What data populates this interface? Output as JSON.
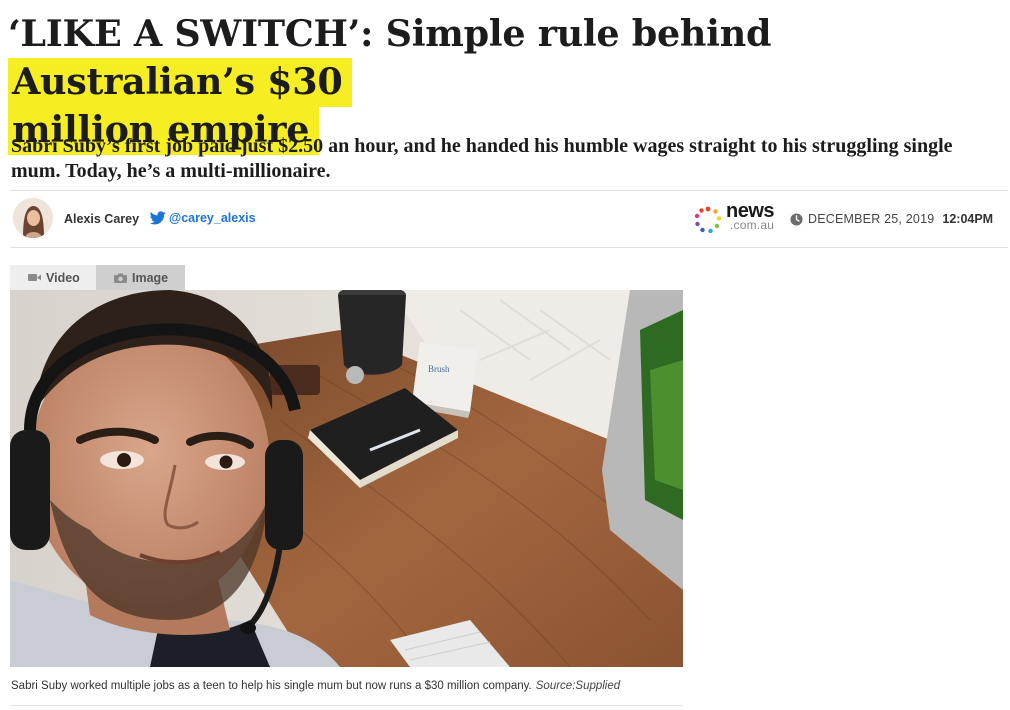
{
  "article": {
    "headline_part1": "‘LIKE A SWITCH’: Simple rule behind ",
    "headline_highlight_line1": "Australian’s $30",
    "headline_highlight_line2": "million empire",
    "standfirst": "Sabri Suby’s first job paid just $2.50 an hour, and he handed his humble wages straight to his struggling single mum. Today, he’s a multi-millionaire.",
    "highlight_color": "#f6ee22"
  },
  "byline": {
    "author": "Alexis Carey",
    "twitter_handle": "@carey_alexis",
    "twitter_icon": "twitter-bird-icon",
    "brand_name": "news",
    "brand_domain": ".com.au",
    "date": "December 25, 2019",
    "time": "12:04pm"
  },
  "media": {
    "tabs": [
      {
        "label": "Video",
        "icon": "video-camera-icon",
        "active": false
      },
      {
        "label": "Image",
        "icon": "camera-icon",
        "active": true
      }
    ],
    "photo_note_text": "Brush",
    "caption": "Sabri Suby worked multiple jobs as a teen to help his single mum but now runs a $30 million company.",
    "source": "Source:Supplied"
  }
}
